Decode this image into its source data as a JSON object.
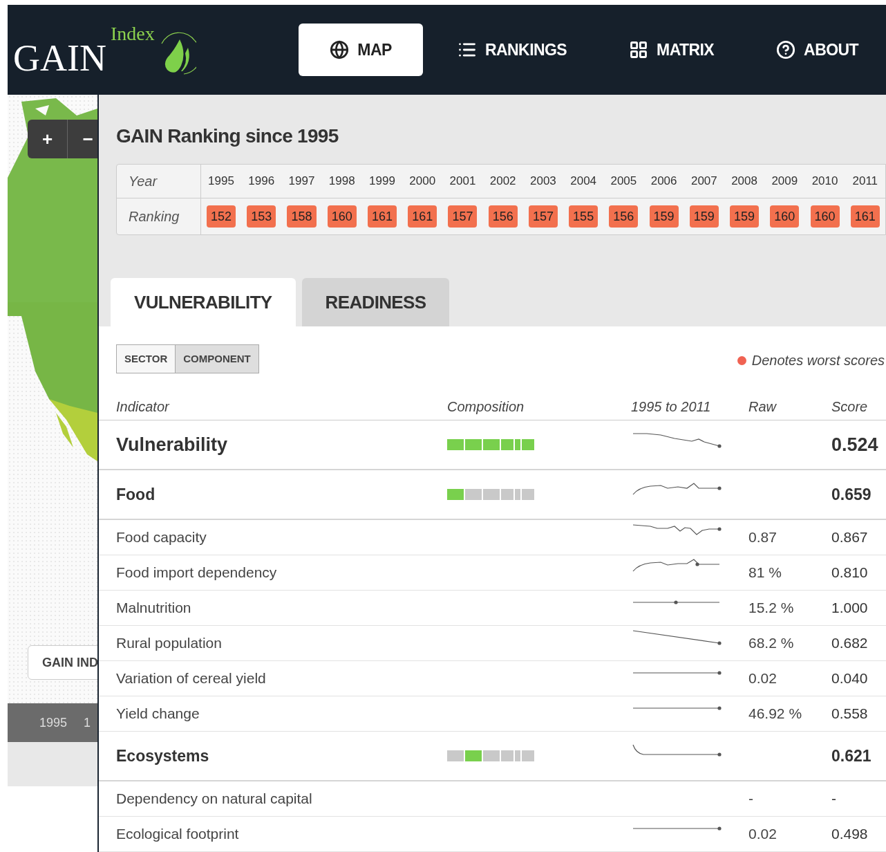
{
  "logo": {
    "main": "GAIN",
    "sub": "Index"
  },
  "nav": [
    {
      "label": "MAP",
      "kind": "globe",
      "selected": true
    },
    {
      "label": "RANKINGS",
      "kind": "list",
      "selected": false
    },
    {
      "label": "MATRIX",
      "kind": "grid",
      "selected": false
    },
    {
      "label": "ABOUT",
      "kind": "help",
      "selected": false
    }
  ],
  "map": {
    "zoom_buttons": [
      "+",
      "−"
    ],
    "index_button": "GAIN IND",
    "timeline": [
      "1995",
      "1"
    ]
  },
  "ranking": {
    "title": "GAIN Ranking since 1995",
    "year_label": "Year",
    "ranking_label": "Ranking",
    "years": [
      "1995",
      "1996",
      "1997",
      "1998",
      "1999",
      "2000",
      "2001",
      "2002",
      "2003",
      "2004",
      "2005",
      "2006",
      "2007",
      "2008",
      "2009",
      "2010",
      "2011"
    ],
    "ranks": [
      "152",
      "153",
      "158",
      "160",
      "161",
      "161",
      "157",
      "156",
      "157",
      "155",
      "156",
      "159",
      "159",
      "159",
      "160",
      "160",
      "161"
    ]
  },
  "tabs": [
    {
      "label": "VULNERABILITY",
      "selected": true
    },
    {
      "label": "READINESS",
      "selected": false
    }
  ],
  "view_toggle": [
    {
      "label": "SECTOR",
      "selected": true
    },
    {
      "label": "COMPONENT",
      "selected": false
    }
  ],
  "legend": "Denotes worst scores",
  "table": {
    "columns": [
      "Indicator",
      "Composition",
      "1995 to 2011",
      "Raw",
      "Score"
    ],
    "rows": [
      {
        "kind": "pillar",
        "name": "Vulnerability",
        "composition": [
          true,
          true,
          true,
          true,
          true,
          true
        ],
        "trend": true,
        "score": "0.524"
      },
      {
        "kind": "sector",
        "name": "Food",
        "composition": [
          true,
          false,
          false,
          false,
          false,
          false
        ],
        "trend": true,
        "score": "0.659"
      },
      {
        "kind": "indicator",
        "name": "Food capacity",
        "trend": true,
        "raw": "0.87",
        "score": "0.867"
      },
      {
        "kind": "indicator",
        "name": "Food import dependency",
        "trend": true,
        "raw": "81 %",
        "score": "0.810"
      },
      {
        "kind": "indicator",
        "name": "Malnutrition",
        "trend": true,
        "raw": "15.2 %",
        "score": "1.000"
      },
      {
        "kind": "indicator",
        "name": "Rural population",
        "trend": true,
        "raw": "68.2 %",
        "score": "0.682"
      },
      {
        "kind": "indicator",
        "name": "Variation of cereal yield",
        "trend": true,
        "raw": "0.02",
        "score": "0.040"
      },
      {
        "kind": "indicator",
        "name": "Yield change",
        "trend": true,
        "raw": "46.92 %",
        "score": "0.558"
      },
      {
        "kind": "sector",
        "name": "Ecosystems",
        "composition": [
          false,
          true,
          false,
          false,
          false,
          false
        ],
        "trend": true,
        "score": "0.621"
      },
      {
        "kind": "indicator",
        "name": "Dependency on natural capital",
        "trend": false,
        "raw": "-",
        "score": "-"
      },
      {
        "kind": "indicator",
        "name": "Ecological footprint",
        "trend": true,
        "raw": "0.02",
        "score": "0.498"
      }
    ]
  }
}
